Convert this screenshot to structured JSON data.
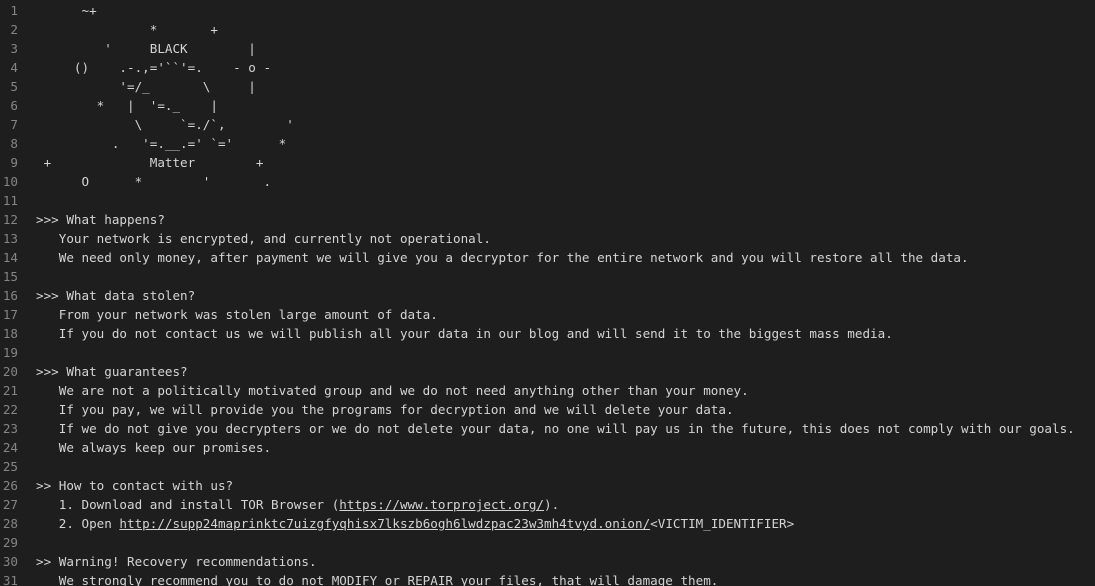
{
  "lines": [
    {
      "n": "1",
      "segments": [
        {
          "text": "      ~+"
        }
      ]
    },
    {
      "n": "2",
      "segments": [
        {
          "text": "               *       +"
        }
      ]
    },
    {
      "n": "3",
      "segments": [
        {
          "text": "         '     BLACK        |"
        }
      ]
    },
    {
      "n": "4",
      "segments": [
        {
          "text": "     ()    .-.,='``'=.    - o -"
        }
      ]
    },
    {
      "n": "5",
      "segments": [
        {
          "text": "           '=/_       \\     |"
        }
      ]
    },
    {
      "n": "6",
      "segments": [
        {
          "text": "        *   |  '=._    |"
        }
      ]
    },
    {
      "n": "7",
      "segments": [
        {
          "text": "             \\     `=./`,        '"
        }
      ]
    },
    {
      "n": "8",
      "segments": [
        {
          "text": "          .   '=.__.=' `='      *"
        }
      ]
    },
    {
      "n": "9",
      "segments": [
        {
          "text": " +             Matter        +"
        }
      ]
    },
    {
      "n": "10",
      "segments": [
        {
          "text": "      O      *        '       ."
        }
      ]
    },
    {
      "n": "11",
      "segments": [
        {
          "text": ""
        }
      ]
    },
    {
      "n": "12",
      "segments": [
        {
          "text": ">>> What happens?"
        }
      ]
    },
    {
      "n": "13",
      "segments": [
        {
          "text": "   Your network is encrypted, and currently not operational."
        }
      ]
    },
    {
      "n": "14",
      "segments": [
        {
          "text": "   We need only money, after payment we will give you a decryptor for the entire network and you will restore all the data."
        }
      ]
    },
    {
      "n": "15",
      "segments": [
        {
          "text": ""
        }
      ]
    },
    {
      "n": "16",
      "segments": [
        {
          "text": ">>> What data stolen?"
        }
      ]
    },
    {
      "n": "17",
      "segments": [
        {
          "text": "   From your network was stolen large amount of data."
        }
      ]
    },
    {
      "n": "18",
      "segments": [
        {
          "text": "   If you do not contact us we will publish all your data in our blog and will send it to the biggest mass media."
        }
      ]
    },
    {
      "n": "19",
      "segments": [
        {
          "text": ""
        }
      ]
    },
    {
      "n": "20",
      "segments": [
        {
          "text": ">>> What guarantees?"
        }
      ]
    },
    {
      "n": "21",
      "segments": [
        {
          "text": "   We are not a politically motivated group and we do not need anything other than your money."
        }
      ]
    },
    {
      "n": "22",
      "segments": [
        {
          "text": "   If you pay, we will provide you the programs for decryption and we will delete your data."
        }
      ]
    },
    {
      "n": "23",
      "segments": [
        {
          "text": "   If we do not give you decrypters or we do not delete your data, no one will pay us in the future, this does not comply with our goals."
        }
      ]
    },
    {
      "n": "24",
      "segments": [
        {
          "text": "   We always keep our promises."
        }
      ]
    },
    {
      "n": "25",
      "segments": [
        {
          "text": ""
        }
      ]
    },
    {
      "n": "26",
      "segments": [
        {
          "text": ">> How to contact with us?"
        }
      ]
    },
    {
      "n": "27",
      "segments": [
        {
          "text": "   1. Download and install TOR Browser ("
        },
        {
          "text": "https://www.torproject.org/",
          "link": true
        },
        {
          "text": ")."
        }
      ]
    },
    {
      "n": "28",
      "segments": [
        {
          "text": "   2. Open "
        },
        {
          "text": "http://supp24maprinktc7uizgfyqhisx7lkszb6ogh6lwdzpac23w3mh4tvyd.onion/",
          "link": true
        },
        {
          "text": "<VICTIM_IDENTIFIER>"
        }
      ]
    },
    {
      "n": "29",
      "segments": [
        {
          "text": ""
        }
      ]
    },
    {
      "n": "30",
      "segments": [
        {
          "text": ">> Warning! Recovery recommendations."
        }
      ]
    },
    {
      "n": "31",
      "segments": [
        {
          "text": "   We strongly recommend you to do not MODIFY or REPAIR your files, that will damage them."
        }
      ]
    }
  ]
}
